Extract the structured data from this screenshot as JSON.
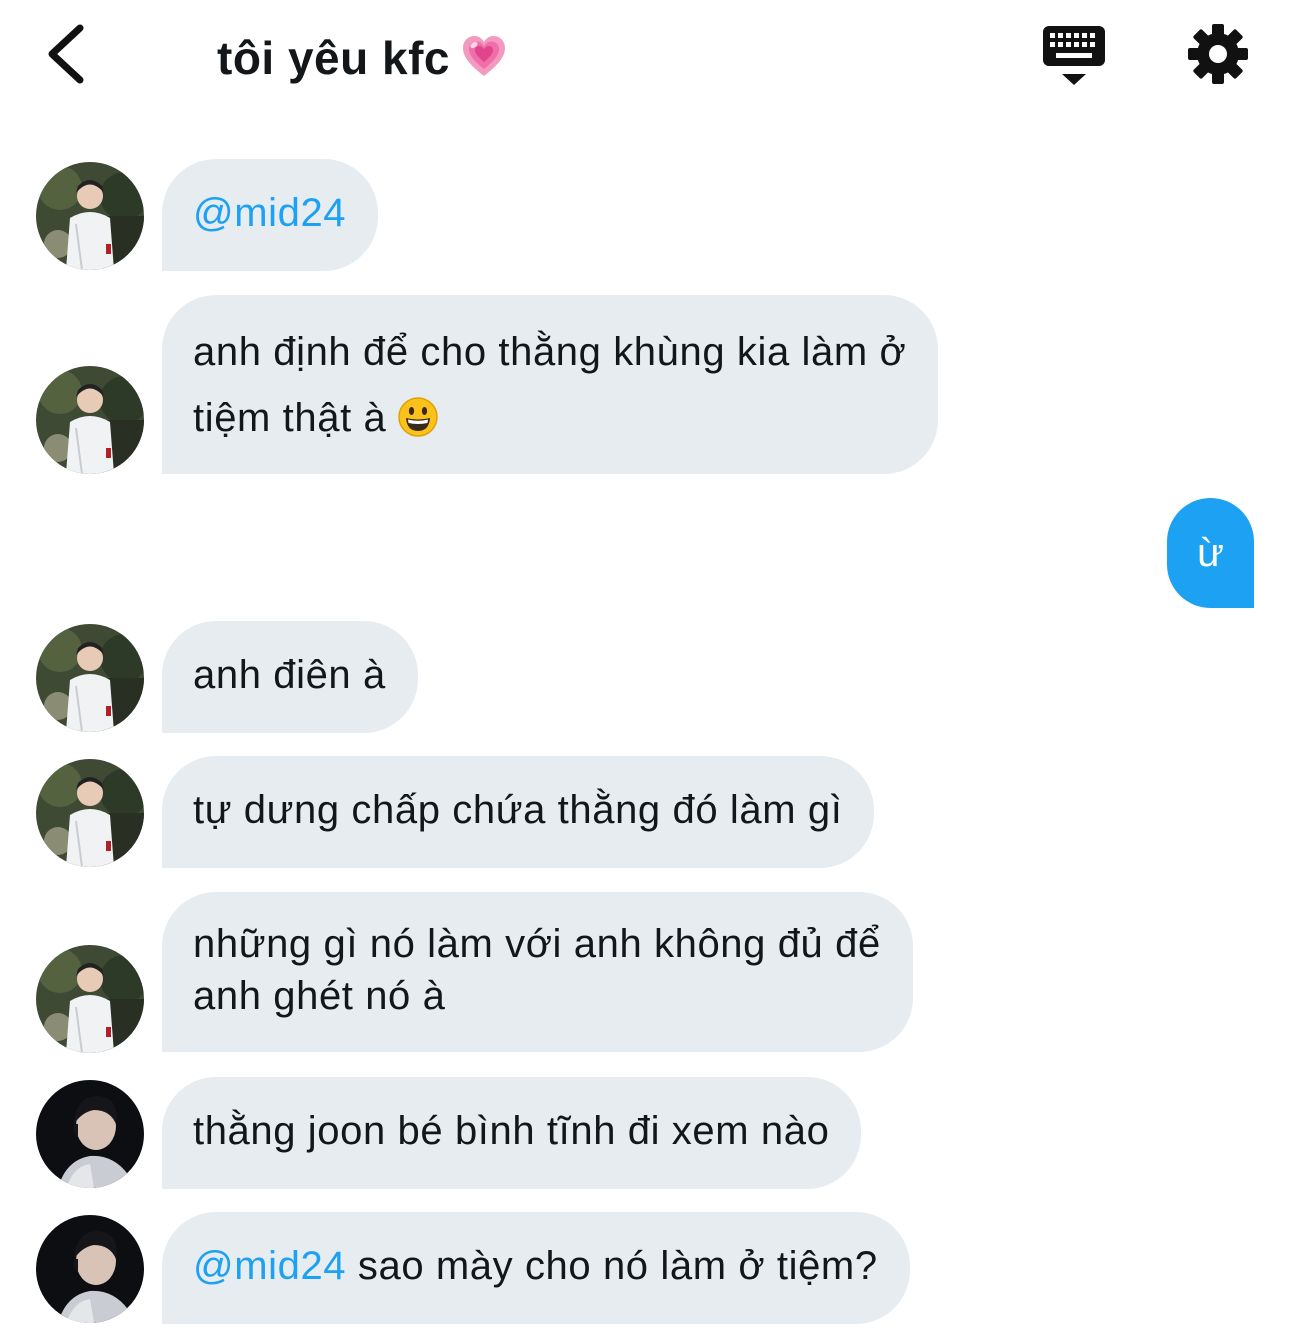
{
  "header": {
    "title": "tôi yêu kfc",
    "title_emoji": "growing-heart-emoji",
    "icons": [
      "back-arrow-icon",
      "keyboard-icon",
      "gear-icon"
    ]
  },
  "colors": {
    "accent": "#1da1f2",
    "received_bubble": "#e6ecf0",
    "text": "#14171a"
  },
  "messages": [
    {
      "sender": "user-a",
      "mention": "@mid24",
      "text": ""
    },
    {
      "sender": "user-a",
      "line1": "anh định để cho thằng khùng kia làm ở",
      "line2": "tiệm thật à",
      "emoji": "grinning-face-emoji"
    },
    {
      "sender": "me",
      "text": "ừ"
    },
    {
      "sender": "user-a",
      "text": "anh điên à"
    },
    {
      "sender": "user-a",
      "text": "tự dưng chấp chứa thằng đó làm gì"
    },
    {
      "sender": "user-a",
      "line1": "những gì nó làm với anh không đủ để",
      "line2": "anh ghét nó à"
    },
    {
      "sender": "user-b",
      "text": "thằng joon bé bình tĩnh đi xem nào"
    },
    {
      "sender": "user-b",
      "mention": "@mid24",
      "text": " sao mày cho nó làm ở tiệm?"
    }
  ]
}
